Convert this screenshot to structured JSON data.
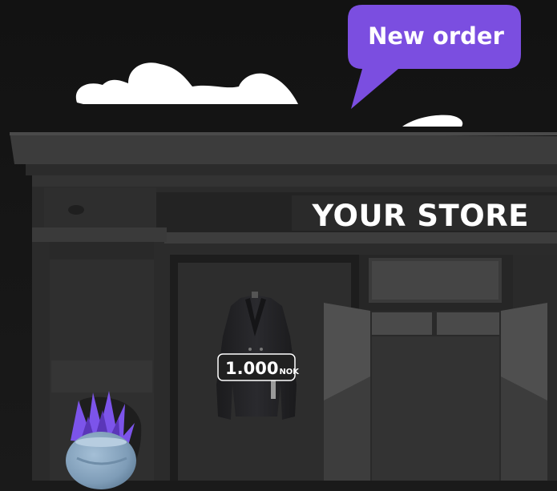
{
  "speech_bubble": {
    "text": "New order",
    "color": "#7b4ee0"
  },
  "store_sign": {
    "text": "YOUR STORE"
  },
  "price_tag": {
    "amount": "1.000",
    "currency": "NOK"
  },
  "icons": {
    "product": "coat-icon",
    "plant": "potted-plant-icon"
  },
  "colors": {
    "background": "#131313",
    "facade": "#2f2f2f",
    "plant": "#7c54ea",
    "pot": "#8ba9c3"
  }
}
